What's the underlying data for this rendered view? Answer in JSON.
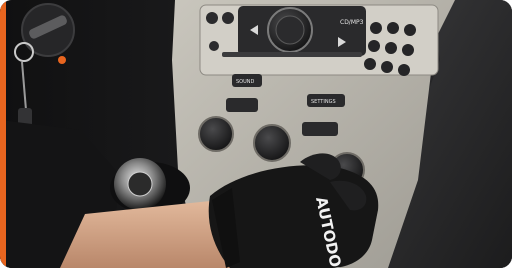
{
  "photo": {
    "radio": {
      "cd_mp3_label": "CD/MP3",
      "sound_label": "SOUND",
      "settings_label": "SETTINGS"
    },
    "glove_brand": "AUTODOC"
  },
  "colors": {
    "accent": "#e8651f",
    "dashboard_silver": "#b9b6ad",
    "glove": "#161616",
    "glove_print": "#f2f2f2",
    "brand_orange": "#f08a1e"
  }
}
